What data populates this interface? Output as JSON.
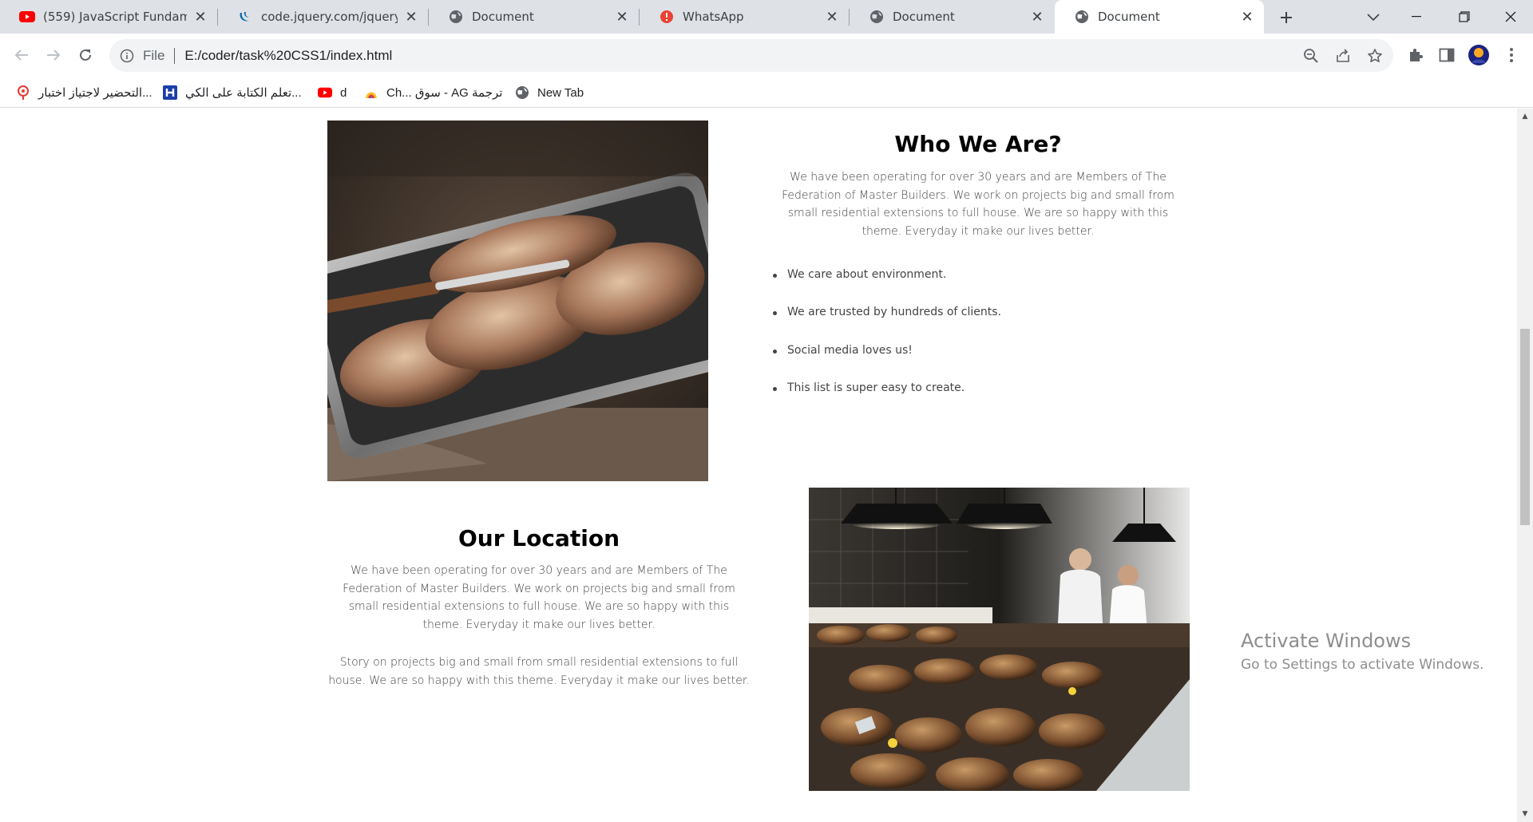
{
  "browser": {
    "tabs": [
      {
        "title": "(559) JavaScript Fundament",
        "icon": "youtube-icon",
        "active": false
      },
      {
        "title": "code.jquery.com/jquery-3.7",
        "icon": "jquery-icon",
        "active": false
      },
      {
        "title": "Document",
        "icon": "globe-icon",
        "active": false
      },
      {
        "title": "WhatsApp",
        "icon": "alert-icon",
        "active": false
      },
      {
        "title": "Document",
        "icon": "globe-icon",
        "active": false
      },
      {
        "title": "Document",
        "icon": "globe-icon",
        "active": true
      }
    ],
    "address": {
      "scheme_label": "File",
      "url": "E:/coder/task%20CSS1/index.html"
    },
    "bookmarks": [
      {
        "label": "التحضير لاجتياز اختبار...",
        "icon": "pin-icon"
      },
      {
        "label": "تعلم الكتابة على الكي...",
        "icon": "h-logo-icon"
      },
      {
        "label": "d",
        "icon": "youtube-icon"
      },
      {
        "label": "Ch... سوق - AG ترجمة",
        "icon": "ag-logo-icon"
      },
      {
        "label": "New Tab",
        "icon": "globe-icon"
      }
    ],
    "colors": {
      "tabstrip": "#dee1e6",
      "omnibox": "#f1f3f4",
      "youtube_red": "#ff0000",
      "whatsapp_alert": "#ea4335"
    }
  },
  "page": {
    "who_we_are": {
      "title": "Who We Are?",
      "paragraph": "We have been operating for over 30 years and are Members of The Federation of Master Builders. We work on projects big and small from small residential extensions to full house. We are so happy with this theme. Everyday it make our lives better.",
      "features": [
        "We care about environment.",
        "We are trusted by hundreds of clients.",
        "Social media loves us!",
        "This list is super easy to create."
      ],
      "image": "bread-tray-photo"
    },
    "our_location": {
      "title": "Our Location",
      "paragraph_1": "We have been operating for over 30 years and are Members of The Federation of Master Builders. We work on projects big and small from small residential extensions to full house. We are so happy with this theme. Everyday it make our lives better.",
      "paragraph_2": "Story on projects big and small from small residential extensions to full house. We are so happy with this theme. Everyday it make our lives better.",
      "image": "bakery-counter-photo"
    }
  },
  "os": {
    "watermark_title": "Activate Windows",
    "watermark_subtitle": "Go to Settings to activate Windows."
  }
}
